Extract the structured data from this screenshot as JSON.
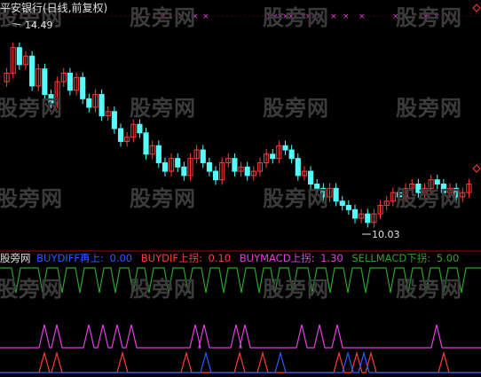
{
  "title": "平安银行(日线,前复权)",
  "watermark": "股旁网",
  "indicator_name": "股旁网",
  "colors": {
    "background": "#000000",
    "up": "#ff3c3c",
    "down": "#54fcfc",
    "buydiff": "#2a5cff",
    "buydif": "#ff3c3c",
    "buymacd": "#e040e0",
    "sellmacd": "#2ca02c",
    "title": "#e0e0e0"
  },
  "legend": {
    "buydiff_label": "BUYDIFF再上:",
    "buydiff_value": "0.00",
    "buydif_label": "BUYDIF上拐:",
    "buydif_value": "0.10",
    "buymacd_label": "BUYMACD上拐:",
    "buymacd_value": "1.30",
    "sellmacd_label": "SELLMACD下拐:",
    "sellmacd_value": "5.00"
  },
  "price_labels": {
    "high": "14.49",
    "low": "10.03"
  },
  "chart_data": {
    "type": "candlestick",
    "ylim": [
      9.7,
      14.9
    ],
    "closes": [
      13.6,
      14.2,
      13.8,
      14.0,
      13.3,
      13.7,
      13.1,
      12.9,
      13.4,
      13.6,
      13.2,
      13.5,
      13.0,
      12.8,
      13.1,
      12.6,
      12.7,
      12.3,
      12.0,
      12.1,
      12.4,
      12.2,
      11.7,
      11.9,
      11.5,
      11.3,
      11.6,
      11.4,
      11.2,
      11.6,
      11.8,
      11.5,
      11.3,
      11.1,
      11.5,
      11.6,
      11.3,
      11.4,
      11.2,
      11.3,
      11.5,
      11.7,
      11.6,
      11.9,
      11.8,
      11.6,
      11.2,
      11.3,
      11.0,
      10.9,
      10.7,
      10.9,
      10.6,
      10.5,
      10.4,
      10.2,
      10.3,
      10.1,
      10.3,
      10.5,
      10.6,
      10.8,
      10.7,
      10.9,
      11.0,
      10.8,
      10.9,
      11.1,
      11.0,
      10.8,
      10.9,
      10.7,
      10.8,
      11.0
    ]
  },
  "signal_markers_top": "× × × × × ×××× × × × × ×"
}
